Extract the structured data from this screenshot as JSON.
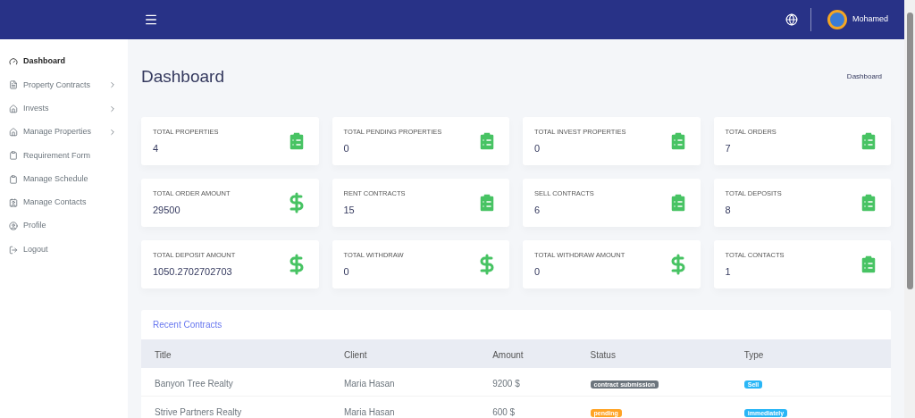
{
  "header": {
    "user": "Mohamed"
  },
  "sidebar": {
    "items": [
      {
        "label": "Dashboard",
        "selected": true,
        "expandable": false
      },
      {
        "label": "Property Contracts",
        "selected": false,
        "expandable": true
      },
      {
        "label": "Invests",
        "selected": false,
        "expandable": true
      },
      {
        "label": "Manage Properties",
        "selected": false,
        "expandable": true
      },
      {
        "label": "Requirement Form",
        "selected": false,
        "expandable": false
      },
      {
        "label": "Manage Schedule",
        "selected": false,
        "expandable": false
      },
      {
        "label": "Manage Contacts",
        "selected": false,
        "expandable": false
      },
      {
        "label": "Profile",
        "selected": false,
        "expandable": false
      },
      {
        "label": "Logout",
        "selected": false,
        "expandable": false
      }
    ]
  },
  "page": {
    "title": "Dashboard",
    "breadcrumb": "Dashboard"
  },
  "stats": [
    {
      "label": "TOTAL PROPERTIES",
      "value": "4",
      "kind": "clipboard"
    },
    {
      "label": "TOTAL PENDING PROPERTIES",
      "value": "0",
      "kind": "clipboard"
    },
    {
      "label": "TOTAL INVEST PROPERTIES",
      "value": "0",
      "kind": "clipboard"
    },
    {
      "label": "TOTAL ORDERS",
      "value": "7",
      "kind": "clipboard"
    },
    {
      "label": "TOTAL ORDER AMOUNT",
      "value": "29500",
      "kind": "dollar"
    },
    {
      "label": "RENT CONTRACTS",
      "value": "15",
      "kind": "clipboard"
    },
    {
      "label": "SELL CONTRACTS",
      "value": "6",
      "kind": "clipboard"
    },
    {
      "label": "TOTAL DEPOSITS",
      "value": "8",
      "kind": "clipboard"
    },
    {
      "label": "TOTAL DEPOSIT AMOUNT",
      "value": "1050.2702702703",
      "kind": "dollar"
    },
    {
      "label": "TOTAL WITHDRAW",
      "value": "0",
      "kind": "dollar"
    },
    {
      "label": "TOTAL WITHDRAW AMOUNT",
      "value": "0",
      "kind": "dollar"
    },
    {
      "label": "TOTAL CONTACTS",
      "value": "1",
      "kind": "clipboard"
    }
  ],
  "recent_contracts": {
    "title": "Recent Contracts",
    "columns": [
      "Title",
      "Client",
      "Amount",
      "Status",
      "Type"
    ],
    "rows": [
      {
        "title": "Banyon Tree Realty",
        "client": "Maria Hasan",
        "amount": "9200 $",
        "status": {
          "text": "contract submission",
          "color": "#6c757d"
        },
        "type": {
          "text": "Sell",
          "color": "#29b6f6"
        }
      },
      {
        "title": "Strive Partners Realty",
        "client": "Maria Hasan",
        "amount": "600 $",
        "status": {
          "text": "pending",
          "color": "#ffa426"
        },
        "type": {
          "text": "immediately",
          "color": "#29b6f6"
        }
      }
    ]
  }
}
